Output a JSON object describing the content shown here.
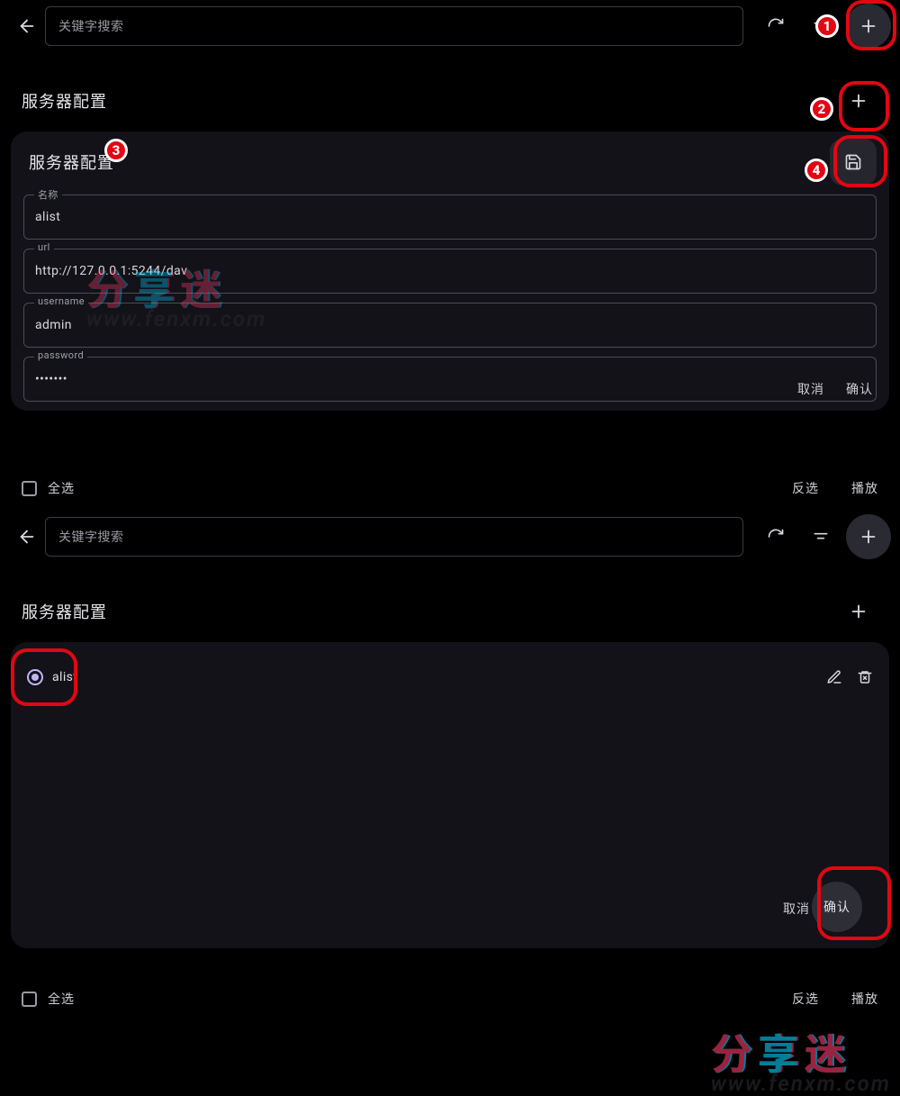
{
  "top": {
    "search_placeholder": "关键字搜索",
    "section_title": "服务器配置",
    "card_title": "服务器配置",
    "fields": {
      "name_label": "名称",
      "name_value": "alist",
      "url_label": "url",
      "url_value": "http://127.0.0.1:5244/dav",
      "user_label": "username",
      "user_value": "admin",
      "pw_label": "password",
      "pw_value": "•••••••"
    },
    "actions": {
      "cancel": "取消",
      "confirm": "确认"
    },
    "bottombar": {
      "select_all": "全选",
      "invert": "反选",
      "play": "播放"
    }
  },
  "bottom": {
    "search_placeholder": "关键字搜索",
    "section_title": "服务器配置",
    "server_item_name": "alist",
    "actions": {
      "cancel": "取消",
      "confirm": "确认"
    },
    "bottombar": {
      "select_all": "全选",
      "invert": "反选",
      "play": "播放"
    }
  },
  "watermark": {
    "zh": "分享迷",
    "url": "www.fenxm.com"
  },
  "callouts": {
    "n1": "1",
    "n2": "2",
    "n3": "3",
    "n4": "4"
  }
}
